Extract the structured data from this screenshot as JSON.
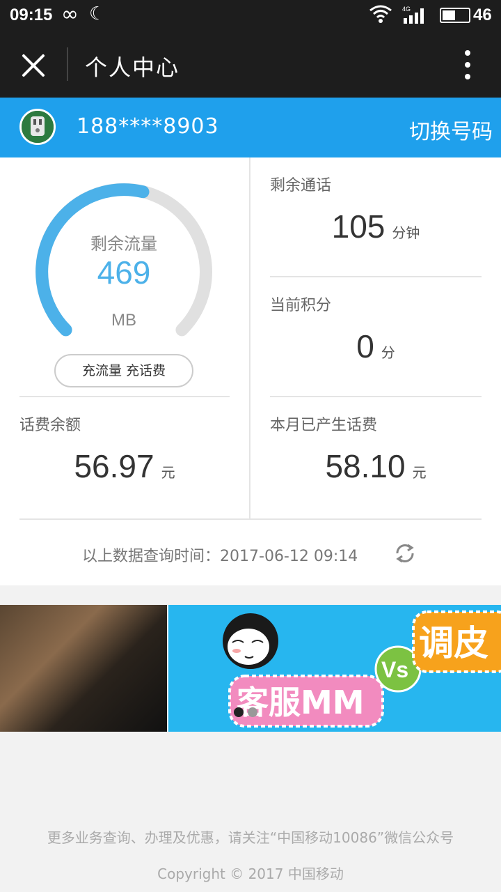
{
  "status_bar": {
    "time": "09:15",
    "network": "4G",
    "battery": "46"
  },
  "header": {
    "title": "个人中心"
  },
  "account": {
    "phone": "188****8903",
    "switch_label": "切换号码"
  },
  "data_usage": {
    "label": "剩余流量",
    "value": "469",
    "unit": "MB",
    "remaining_fraction": 0.55,
    "recharge_label": "充流量 充话费"
  },
  "call_time": {
    "label": "剩余通话",
    "value": "105",
    "unit": "分钟"
  },
  "points": {
    "label": "当前积分",
    "value": "0",
    "unit": "分"
  },
  "balance": {
    "label": "话费余额",
    "value": "56.97",
    "unit": "元"
  },
  "monthly_fee": {
    "label": "本月已产生话费",
    "value": "58.10",
    "unit": "元"
  },
  "query_time": {
    "label": "以上数据查询时间：",
    "value": "2017-06-12 09:14"
  },
  "banner": {
    "text_left": "客服MM",
    "text_vs": "Vs",
    "text_right": "调皮",
    "slides": 2,
    "active_slide": 1
  },
  "footer": {
    "notice": "更多业务查询、办理及优惠，请关注“中国移动10086”微信公众号",
    "copyright": "Copyright © 2017 中国移动"
  },
  "colors": {
    "accent": "#1fa0ec",
    "gauge": "#4cb1e9",
    "dark": "#1d1d1d"
  }
}
